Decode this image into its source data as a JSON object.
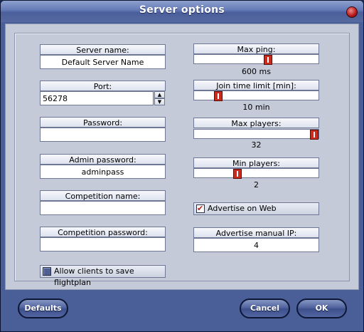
{
  "window": {
    "title": "Server options"
  },
  "left": {
    "server_name": {
      "label": "Server name:",
      "value": "Default Server Name"
    },
    "port": {
      "label": "Port:",
      "value": "56278"
    },
    "password": {
      "label": "Password:",
      "value": ""
    },
    "admin_password": {
      "label": "Admin password:",
      "value": "adminpass"
    },
    "competition_name": {
      "label": "Competition name:",
      "value": ""
    },
    "competition_password": {
      "label": "Competition password:",
      "value": ""
    },
    "allow_save": {
      "label": "Allow clients to save flightplan",
      "checked": false
    }
  },
  "right": {
    "max_ping": {
      "label": "Max ping:",
      "value_text": "600 ms",
      "fraction": 0.6
    },
    "join_time": {
      "label": "Join time limit [min]:",
      "value_text": "10 min",
      "fraction": 0.17
    },
    "max_players": {
      "label": "Max players:",
      "value_text": "32",
      "fraction": 1.0
    },
    "min_players": {
      "label": "Min players:",
      "value_text": "2",
      "fraction": 0.34
    },
    "advertise_web": {
      "label": "Advertise on Web",
      "checked": true
    },
    "advertise_ip": {
      "label": "Advertise manual IP:",
      "value": "4"
    }
  },
  "buttons": {
    "defaults": "Defaults",
    "cancel": "Cancel",
    "ok": "OK"
  }
}
